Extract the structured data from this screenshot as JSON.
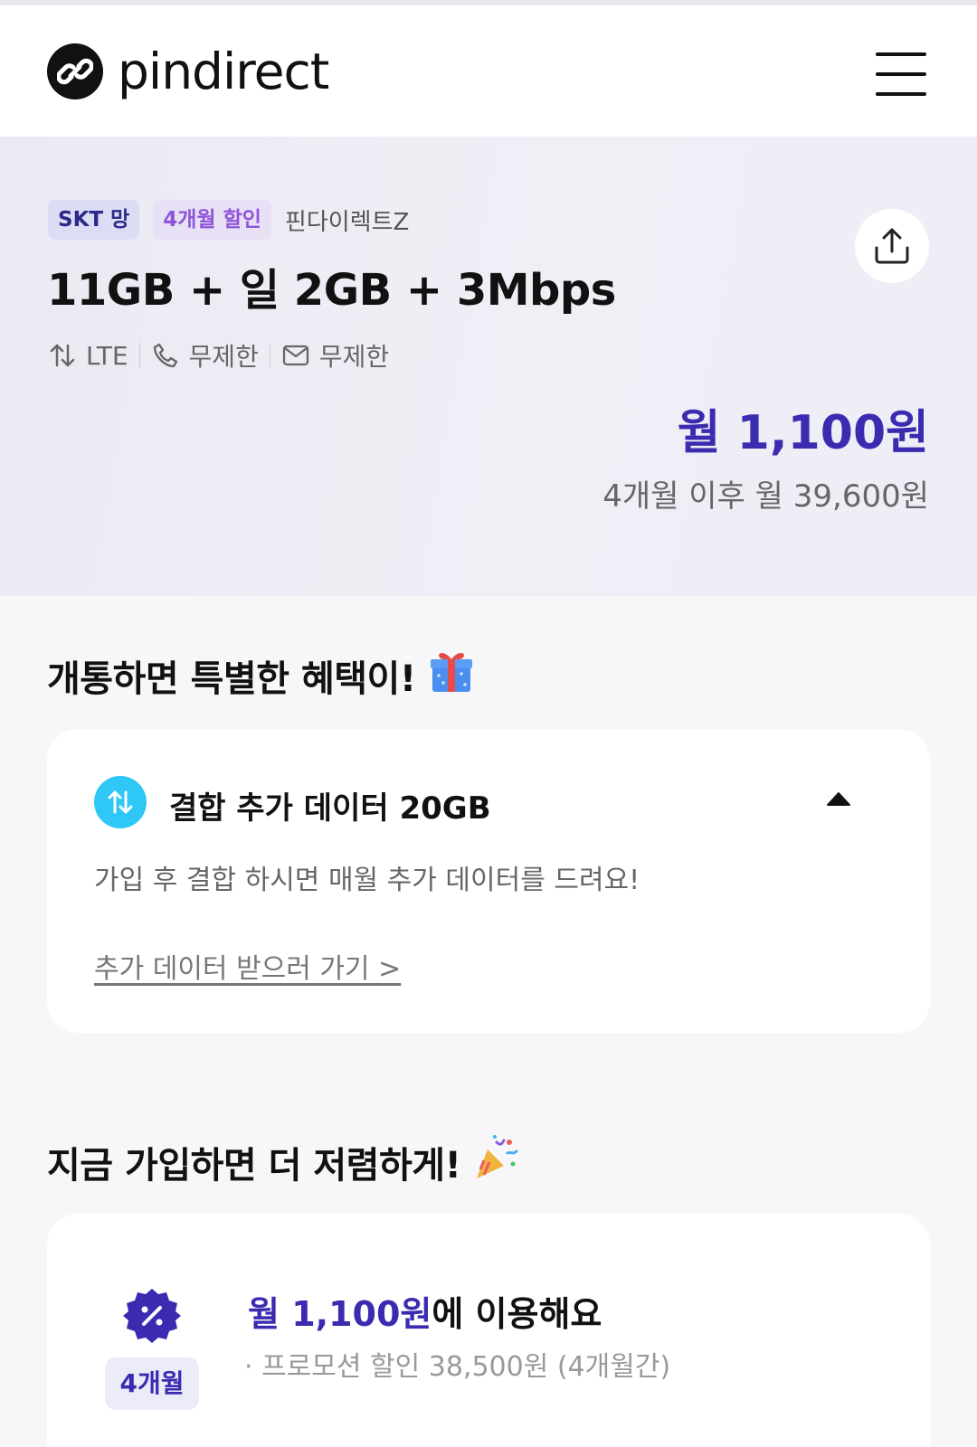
{
  "header": {
    "logo_text": "pindirect"
  },
  "plan": {
    "network_badge": "SKT 망",
    "discount_badge": "4개월 할인",
    "carrier": "핀다이렉트Z",
    "title": "11GB + 일 2GB + 3Mbps",
    "specs": [
      {
        "icon": "data-arrows-icon",
        "label": "LTE"
      },
      {
        "icon": "phone-icon",
        "label": "무제한"
      },
      {
        "icon": "message-icon",
        "label": "무제한"
      }
    ],
    "price": "월 1,100원",
    "price_after": "4개월 이후 월 39,600원"
  },
  "benefit_section": {
    "title": "개통하면 특별한 혜택이!",
    "emoji": "🎁",
    "card": {
      "title": "결합 추가 데이터 20GB",
      "description": "가입 후 결합 하시면 매월 추가 데이터를 드려요!",
      "link": "추가 데이터 받으러 가기 >"
    }
  },
  "promo_section": {
    "title": "지금 가입하면 더 저렴하게!",
    "emoji": "🎉",
    "card": {
      "chip": "4개월",
      "price_accent": "월 1,100원",
      "price_suffix": "에 이용해요",
      "detail": "· 프로모션 할인 38,500원 (4개월간)"
    }
  },
  "colors": {
    "accent": "#3b2bb0",
    "badge_purple": "#8f55d8",
    "benefit_icon": "#2fc7f5"
  }
}
